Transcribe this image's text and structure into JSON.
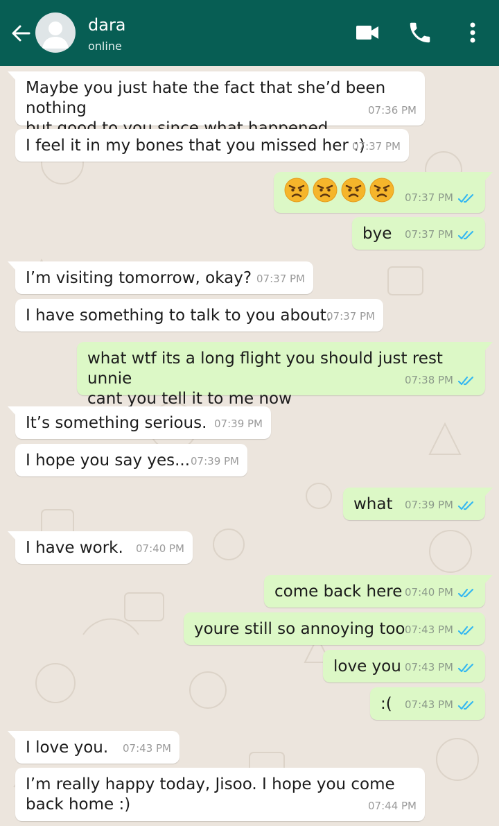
{
  "header": {
    "contact_name": "dara",
    "status": "online"
  },
  "messages": [
    {
      "dir": "in",
      "text": "Maybe you just hate the fact that she’d been nothing\nbut good to you since what happened...",
      "time": "07:36 PM"
    },
    {
      "dir": "in",
      "text": "I feel it in my bones that you missed her :)",
      "time": "07:37 PM"
    },
    {
      "dir": "out",
      "emoji": [
        "angry-face",
        "angry-face",
        "angry-face",
        "angry-face"
      ],
      "time": "07:37 PM",
      "read": true
    },
    {
      "dir": "out",
      "text": "bye",
      "time": "07:37 PM",
      "read": true
    },
    {
      "dir": "in",
      "text": "I’m visiting tomorrow, okay?",
      "time": "07:37 PM"
    },
    {
      "dir": "in",
      "text": "I have something to talk to you about.",
      "time": "07:37 PM"
    },
    {
      "dir": "out",
      "text": "what wtf its a long flight you should just rest unnie\ncant you tell it to me now",
      "time": "07:38 PM",
      "read": true
    },
    {
      "dir": "in",
      "text": "It’s something serious.",
      "time": "07:39 PM"
    },
    {
      "dir": "in",
      "text": "I hope you say yes...",
      "time": "07:39 PM"
    },
    {
      "dir": "out",
      "text": "what",
      "time": "07:39 PM",
      "read": true
    },
    {
      "dir": "in",
      "text": "I have work.",
      "time": "07:40 PM"
    },
    {
      "dir": "out",
      "text": "come back here",
      "time": "07:40 PM",
      "read": true
    },
    {
      "dir": "out",
      "text": "youre still so annoying too",
      "time": "07:43 PM",
      "read": true
    },
    {
      "dir": "out",
      "text": "love you",
      "time": "07:43 PM",
      "read": true
    },
    {
      "dir": "out",
      "text": ":(",
      "time": "07:43 PM",
      "read": true
    },
    {
      "dir": "in",
      "text": "I love you.",
      "time": "07:43 PM"
    },
    {
      "dir": "in",
      "text": "I’m really happy today, Jisoo. I hope you come\nback home :)",
      "time": "07:44 PM"
    }
  ],
  "colors": {
    "header": "#075e54",
    "background": "#ece5dd",
    "incoming_bubble": "#ffffff",
    "outgoing_bubble": "#dcf8c6",
    "read_ticks": "#34b7f1"
  }
}
